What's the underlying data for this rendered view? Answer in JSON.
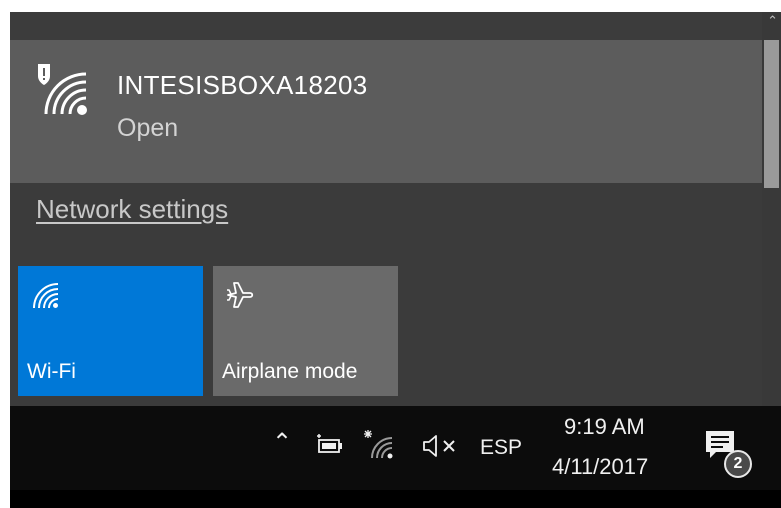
{
  "network": {
    "name": "INTESISBOXA18203",
    "status": "Open",
    "icon": "wifi-secured-warning-icon"
  },
  "settings_link": "Network settings",
  "quick_actions": [
    {
      "label": "Wi-Fi",
      "icon": "wifi-icon",
      "active": true
    },
    {
      "label": "Airplane mode",
      "icon": "airplane-icon",
      "active": false
    }
  ],
  "taskbar": {
    "language": "ESP",
    "time": "9:19 AM",
    "date": "4/11/2017",
    "notification_count": "2",
    "tray_icons": [
      "chevron-up-icon",
      "battery-charging-icon",
      "wifi-tray-icon",
      "volume-muted-icon"
    ]
  },
  "colors": {
    "flyout_bg": "#3b3b3b",
    "network_item_bg": "#5c5c5c",
    "active_tile": "#0078d7",
    "inactive_tile": "#6a6a6a",
    "taskbar_bg": "#0c0c0c"
  }
}
